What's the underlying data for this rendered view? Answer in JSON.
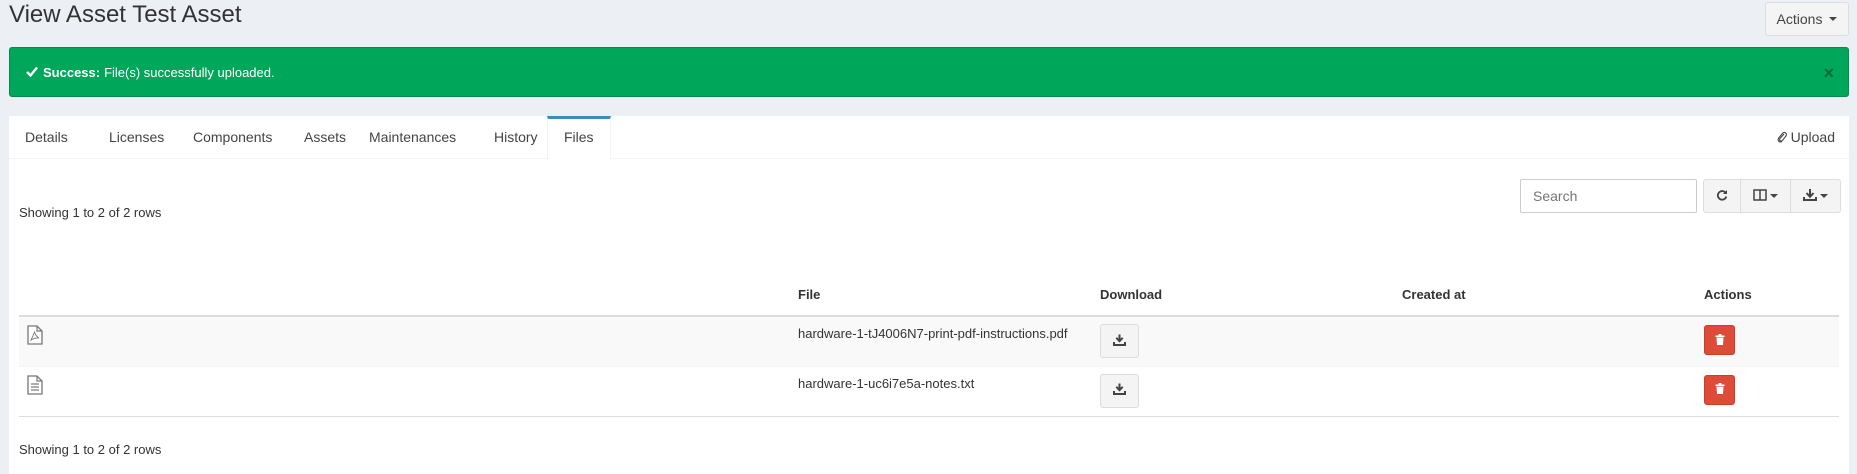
{
  "header": {
    "title": "View Asset Test Asset",
    "actions_label": "Actions"
  },
  "alert": {
    "strong": "Success:",
    "message": "File(s) successfully uploaded.",
    "close": "×",
    "color": "#00a65a"
  },
  "tabs": [
    {
      "label": "Details"
    },
    {
      "label": "Licenses"
    },
    {
      "label": "Components"
    },
    {
      "label": "Assets"
    },
    {
      "label": "Maintenances"
    },
    {
      "label": "History"
    },
    {
      "label": "Files",
      "active": true
    }
  ],
  "upload_label": "Upload",
  "toolbar": {
    "search_placeholder": "Search",
    "refresh_icon": "refresh-icon",
    "columns_icon": "columns-icon",
    "export_icon": "download-icon"
  },
  "pagination": {
    "top_text": "Showing 1 to 2 of 2 rows",
    "bottom_text": "Showing 1 to 2 of 2 rows"
  },
  "table": {
    "columns": [
      "",
      "File",
      "Download",
      "Created at",
      "Actions"
    ],
    "rows": [
      {
        "icon": "pdf-file-icon",
        "file": "hardware-1-tJ4006N7-print-pdf-instructions.pdf",
        "created_at": ""
      },
      {
        "icon": "text-file-icon",
        "file": "hardware-1-uc6i7e5a-notes.txt",
        "created_at": ""
      }
    ]
  },
  "colors": {
    "accent": "#3c8dbc",
    "danger": "#dd4b39",
    "success": "#00a65a"
  }
}
